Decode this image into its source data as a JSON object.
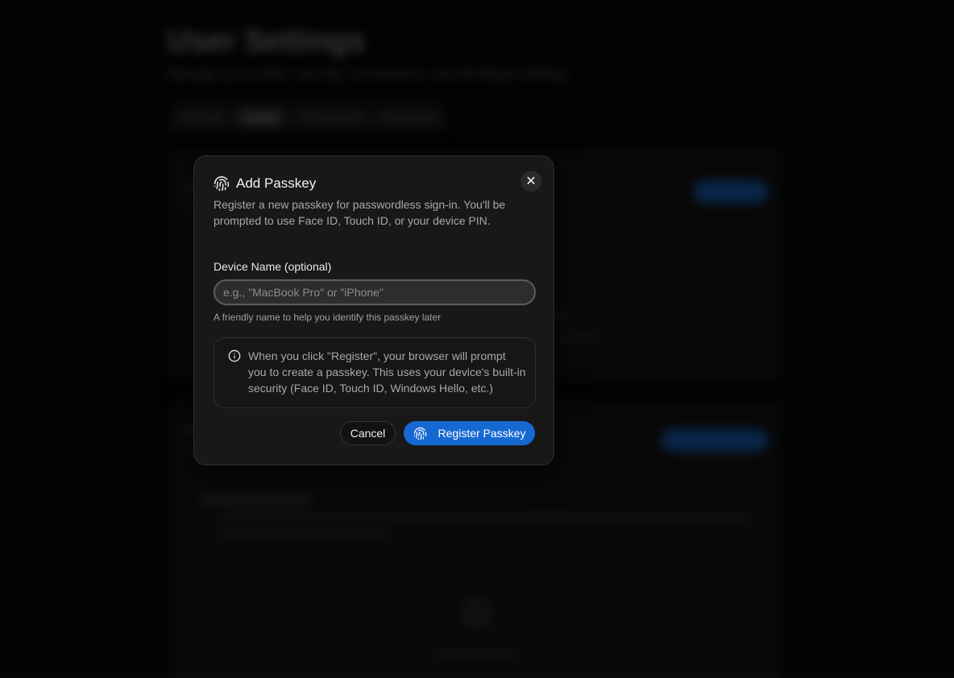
{
  "dialog": {
    "title": "Add Passkey",
    "description": "Register a new passkey for passwordless sign-in. You'll be prompted to use Face ID, Touch ID, or your device PIN.",
    "close_label": "✕",
    "field": {
      "label": "Device Name (optional)",
      "value": "",
      "placeholder": "e.g., \"MacBook Pro\" or \"iPhone\"",
      "hint": "A friendly name to help you identify this passkey later"
    },
    "info": "When you click \"Register\", your browser will prompt you to create a passkey. This uses your device's built-in security (Face ID, Touch ID, Windows Hello, etc.)",
    "cancel_label": "Cancel",
    "register_label": "Register Passkey"
  },
  "background": {
    "title": "User Settings",
    "subtitle": "Manage your profile, security, connections, and developer settings",
    "tabs": [
      "Security",
      "Details",
      "Connections",
      "Developer"
    ],
    "active_tab": 1,
    "empty_state": "No passkeys yet"
  },
  "colors": {
    "accent": "#1769d2",
    "dialog_bg": "#181818",
    "page_bg": "#050505"
  }
}
